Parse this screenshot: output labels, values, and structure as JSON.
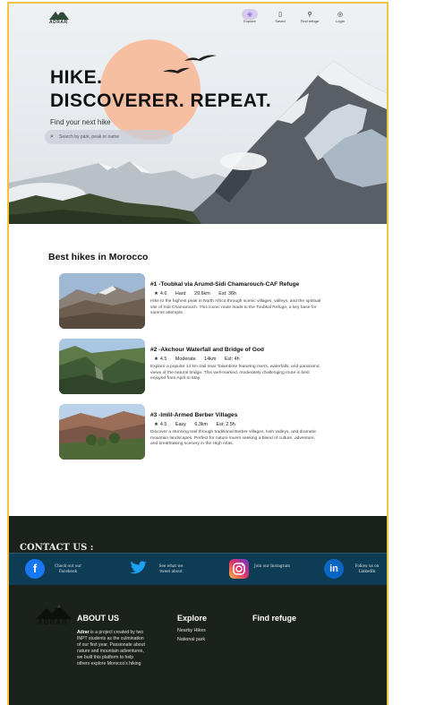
{
  "nav": {
    "brand": "ADRAR",
    "items": [
      {
        "label": "Explore",
        "icon": "location-pin-icon"
      },
      {
        "label": "Saved",
        "icon": "bookmark-icon"
      },
      {
        "label": "Find refuge",
        "icon": "search-icon"
      },
      {
        "label": "Login",
        "icon": "user-icon"
      }
    ]
  },
  "hero": {
    "headline_line1": "HIKE.",
    "headline_line2": "DISCOVERER. REPEAT.",
    "subtitle": "Find your next hike",
    "search_placeholder": "Search by park, peak or name"
  },
  "best_hikes": {
    "title": "Best hikes in Morocco",
    "items": [
      {
        "title": "#1 -Toubkal via Arumd-Sidi Chamarouch-CAF Refuge",
        "rating": "4.6",
        "difficulty": "Hard",
        "distance": "29.6km",
        "time": "Est: 36h",
        "description": "Hike to the highest peak in North Africa through scenic villages, valleys, and the spiritual site of Sidi Chamarouch. This iconic route leads to the Toubkal Refuge, a key base for summit attempts."
      },
      {
        "title": "#2 -Akchour Waterfall and Bridge of God",
        "rating": "4.5",
        "difficulty": "Moderate",
        "distance": "14km",
        "time": "Est: 4h",
        "description": "Explore a popular 14 km trail near Talambote featuring rivers, waterfalls, and panoramic views of the natural bridge. This well-marked, moderately challenging route is best enjoyed from April to May."
      },
      {
        "title": "#3 -Imlil-Armed Berber Villages",
        "rating": "4.5",
        "difficulty": "Easy",
        "distance": "6.3km",
        "time": "Est: 2.5h",
        "description": "Discover a stunning trail through traditional Berber villages, lush valleys, and dramatic mountain landscapes. Perfect for nature lovers seeking a blend of culture, adventure, and breathtaking scenery in the High Atlas."
      }
    ]
  },
  "footer": {
    "contact_title": "CONTACT US :",
    "socials": [
      {
        "icon": "facebook-icon",
        "text": "Check out our Facebook",
        "color": "#1877f2"
      },
      {
        "icon": "twitter-icon",
        "text": "See what we tweet about",
        "color": "#1da1f2"
      },
      {
        "icon": "instagram-icon",
        "text": "Join our Instagram",
        "color": "#d6249f"
      },
      {
        "icon": "linkedin-icon",
        "text": "Follow us on LinkedIn",
        "color": "#0a66c2"
      }
    ],
    "brand": "ADRAR",
    "about_title": "ABOUT US",
    "about_brand": "Adrar",
    "about_text": " is a project created by two INPT students as the culmination of our first year. Passionate about nature and mountain adventures, we built this platform to help others explore Morocco's hiking",
    "explore_title": "Explore",
    "explore_links": [
      "Nearby Hikes",
      "National park"
    ],
    "refuge_title": "Find refuge"
  },
  "colors": {
    "frame": "#f5c542",
    "footer_bg": "#1b211c",
    "contact_bar": "#0f3c55",
    "sun": "#f6bfa1"
  }
}
